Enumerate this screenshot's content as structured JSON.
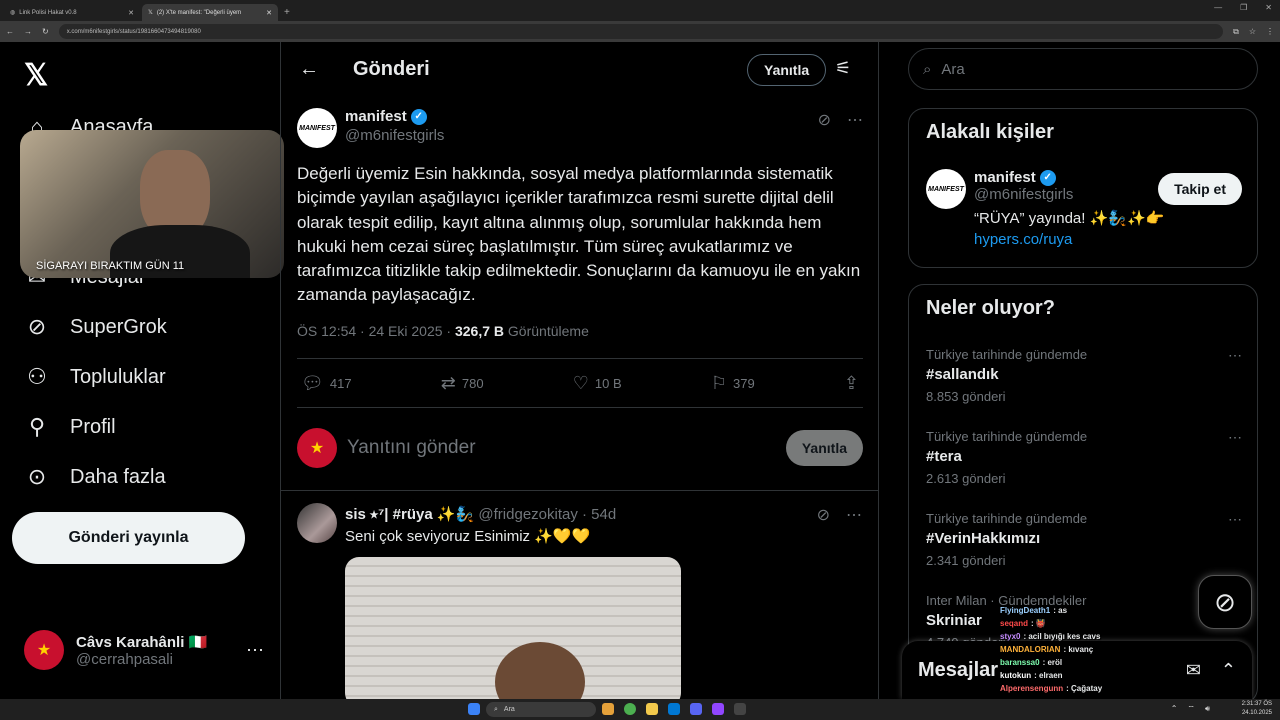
{
  "browser": {
    "tabs": [
      {
        "label": "Link Polisi Hakat v0.8",
        "active": false
      },
      {
        "label": "(2) X'te manifest: \"Değerli üyem",
        "active": true
      }
    ],
    "url": "x.com/m6nifestgirls/status/1981660473494819080"
  },
  "leftnav": {
    "logo": "𝕏",
    "items": [
      {
        "icon": "home-icon",
        "glyph": "⌂",
        "label": "Anasayfa"
      },
      {
        "icon": "mail-icon",
        "glyph": "✉",
        "label": "Mesajlar"
      },
      {
        "icon": "grok-icon",
        "glyph": "⊘",
        "label": "SuperGrok"
      },
      {
        "icon": "communities-icon",
        "glyph": "👥",
        "label": "Topluluklar"
      },
      {
        "icon": "profile-icon",
        "glyph": "👤",
        "label": "Profil"
      },
      {
        "icon": "more-icon",
        "glyph": "⋯",
        "label": "Daha fazla"
      }
    ],
    "post_button": "Gönderi yayınla",
    "user": {
      "name": "Câvs Karahânli 🇮🇹",
      "handle": "@cerrahpasali"
    }
  },
  "webcam": {
    "caption": "SİGARAYI BIRAKTIM GÜN 11"
  },
  "main": {
    "header": {
      "title": "Gönderi",
      "reply_button": "Yanıtla"
    },
    "tweet": {
      "author_name": "manifest",
      "author_handle": "@m6nifestgirls",
      "avatar_text": "MANIFEST",
      "text": "Değerli üyemiz Esin hakkında, sosyal medya platformlarında sistematik biçimde yayılan aşağılayıcı içerikler tarafımızca resmi surette dijital delil olarak tespit edilip, kayıt altına alınmış olup, sorumlular hakkında hem hukuki hem cezai süreç başlatılmıştır. Tüm süreç avukatlarımız ve tarafımızca titizlikle takip edilmektedir. Sonuçlarını da kamuoyu ile en yakın zamanda paylaşacağız.",
      "time": "ÖS 12:54 · 24 Eki 2025 · ",
      "views": "326,7 B",
      "views_label": " Görüntüleme",
      "replies": "417",
      "reposts": "780",
      "likes": "10 B",
      "bookmarks": "379"
    },
    "reply_box": {
      "placeholder": "Yanıtını gönder",
      "button": "Yanıtla"
    },
    "reply": {
      "name": "sis ⭑⁷| #rüya ✨🧞",
      "handle": "@fridgezokitay · 54d",
      "text": "Seni çok seviyoruz Esinimiz ✨💛💛"
    }
  },
  "right": {
    "search_placeholder": "Ara",
    "related": {
      "title": "Alakalı kişiler",
      "name": "manifest",
      "handle": "@m6nifestgirls",
      "bio": "“RÜYA” yayında! ✨🧞✨👉",
      "link": "hypers.co/ruya",
      "follow": "Takip et"
    },
    "trends": {
      "title": "Neler oluyor?",
      "items": [
        {
          "context": "Türkiye tarihinde gündemde",
          "tag": "#sallandık",
          "count": "8.853 gönderi"
        },
        {
          "context": "Türkiye tarihinde gündemde",
          "tag": "#tera",
          "count": "2.613 gönderi"
        },
        {
          "context": "Türkiye tarihinde gündemde",
          "tag": "#VerinHakkımızı",
          "count": "2.341 gönderi"
        },
        {
          "context": "Inter Milan · Gündemdekiler",
          "tag": "Skriniar",
          "count": "4.740 gönderi"
        }
      ]
    },
    "messages_title": "Mesajlar"
  },
  "stream_chat": [
    {
      "user": "FlyingDeath1",
      "msg": ": as",
      "color": "#9bd0ff"
    },
    {
      "user": "seqand",
      "msg": ": 👹",
      "color": "#ff4a4a"
    },
    {
      "user": "styx0",
      "msg": ": acil bıyığı kes cavs",
      "color": "#c58cff"
    },
    {
      "user": "MANDALORIAN",
      "msg": ": kıvanç",
      "color": "#ffb23a"
    },
    {
      "user": "baranssa0",
      "msg": ": eröl",
      "color": "#7fffb0"
    },
    {
      "user": "kutokun",
      "msg": ": elraen",
      "color": "#ffffff"
    },
    {
      "user": "Alperensengunn",
      "msg": ": Çağatay",
      "color": "#ff6b6b"
    }
  ],
  "taskbar": {
    "search": "Ara",
    "time": "2:31:37 ÖS",
    "date": "24.10.2025"
  }
}
